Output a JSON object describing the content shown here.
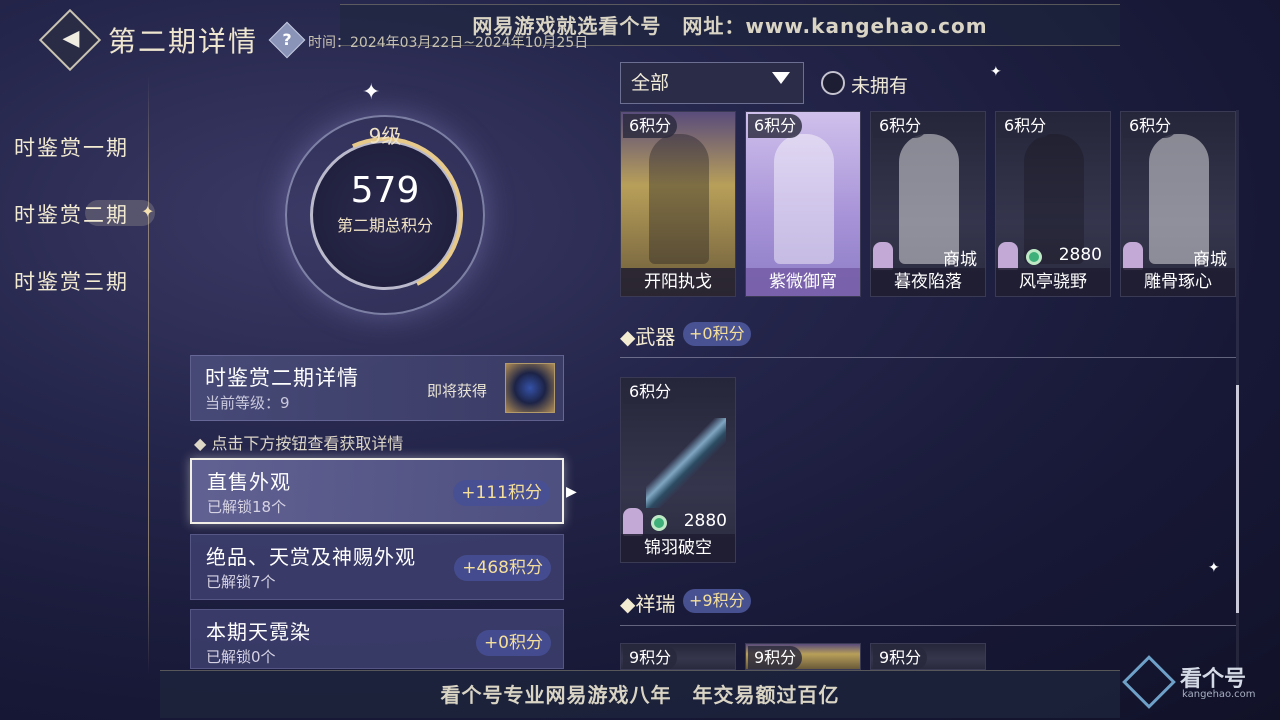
{
  "watermark": {
    "top_text": "网易游戏就选看个号　网址：www.kangehao.com",
    "bottom_text": "看个号专业网易游戏八年　年交易额过百亿"
  },
  "header": {
    "title": "第二期详情",
    "help_symbol": "?",
    "period_time": "时间：2024年03月22日~2024年10月25日"
  },
  "sidebar": {
    "items": [
      {
        "label": "时鉴赏一期"
      },
      {
        "label": "时鉴赏二期"
      },
      {
        "label": "时鉴赏三期"
      }
    ]
  },
  "level": {
    "level_label": "9级",
    "score": "579",
    "score_label": "第二期总积分"
  },
  "detail": {
    "title": "时鉴赏二期详情",
    "current_level": "当前等级：9",
    "soon_label": "即将获得",
    "hint": "点击下方按钮查看获取详情"
  },
  "categories": [
    {
      "title": "直售外观",
      "unlocked": "已解锁18个",
      "points": "+111积分"
    },
    {
      "title": "绝品、天赏及神赐外观",
      "unlocked": "已解锁7个",
      "points": "+468积分"
    },
    {
      "title": "本期天霓染",
      "unlocked": "已解锁0个",
      "points": "+0积分"
    }
  ],
  "filter": {
    "selected": "全部",
    "not_owned_label": "未拥有"
  },
  "outfits": [
    {
      "points": "6积分",
      "name": "开阳执戈",
      "source": ""
    },
    {
      "points": "6积分",
      "name": "紫微御宵",
      "source": ""
    },
    {
      "points": "6积分",
      "name": "暮夜陷落",
      "source": "商城"
    },
    {
      "points": "6积分",
      "name": "风亭骁野",
      "source": "2880"
    },
    {
      "points": "6积分",
      "name": "雕骨琢心",
      "source": "商城"
    }
  ],
  "weapons_section": {
    "title": "武器",
    "points": "+0积分"
  },
  "weapons": [
    {
      "points": "6积分",
      "name": "锦羽破空",
      "source": "2880"
    }
  ],
  "auspicious_section": {
    "title": "祥瑞",
    "points": "+9积分"
  },
  "auspicious": [
    {
      "points": "9积分"
    },
    {
      "points": "9积分"
    },
    {
      "points": "9积分"
    }
  ],
  "logo": {
    "text": "看个号",
    "sub": "kangehao.com"
  },
  "colors": {
    "accent_gold": "#f5df9a",
    "panel": "#3e406e",
    "background": "#171836"
  }
}
